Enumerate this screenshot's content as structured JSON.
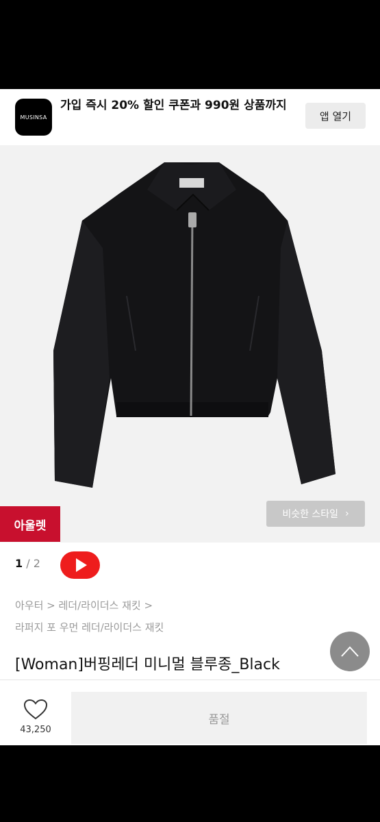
{
  "banner": {
    "app_logo_text": "MUSINSA",
    "promo_text": "가입 즉시 20% 할인 쿠폰과 990원 상품까지",
    "open_app_label": "앱 열기"
  },
  "product_image": {
    "outlet_badge": "아울렛",
    "similar_style_label": "비슷한 스타일",
    "similar_style_arrow": "›"
  },
  "pager": {
    "current": "1",
    "separator": " / ",
    "total": "2"
  },
  "breadcrumb": {
    "line1": "아우터 > 레더/라이더스 재킷 >",
    "line2": "라퍼지 포 우먼 레더/라이더스 재킷"
  },
  "product": {
    "title": "[Woman]버핑레더 미니멀 블루종_Black"
  },
  "bottom_bar": {
    "like_count": "43,250",
    "soldout_label": "품절"
  },
  "colors": {
    "accent_red": "#c8102e",
    "youtube_red": "#ee1d1d"
  }
}
